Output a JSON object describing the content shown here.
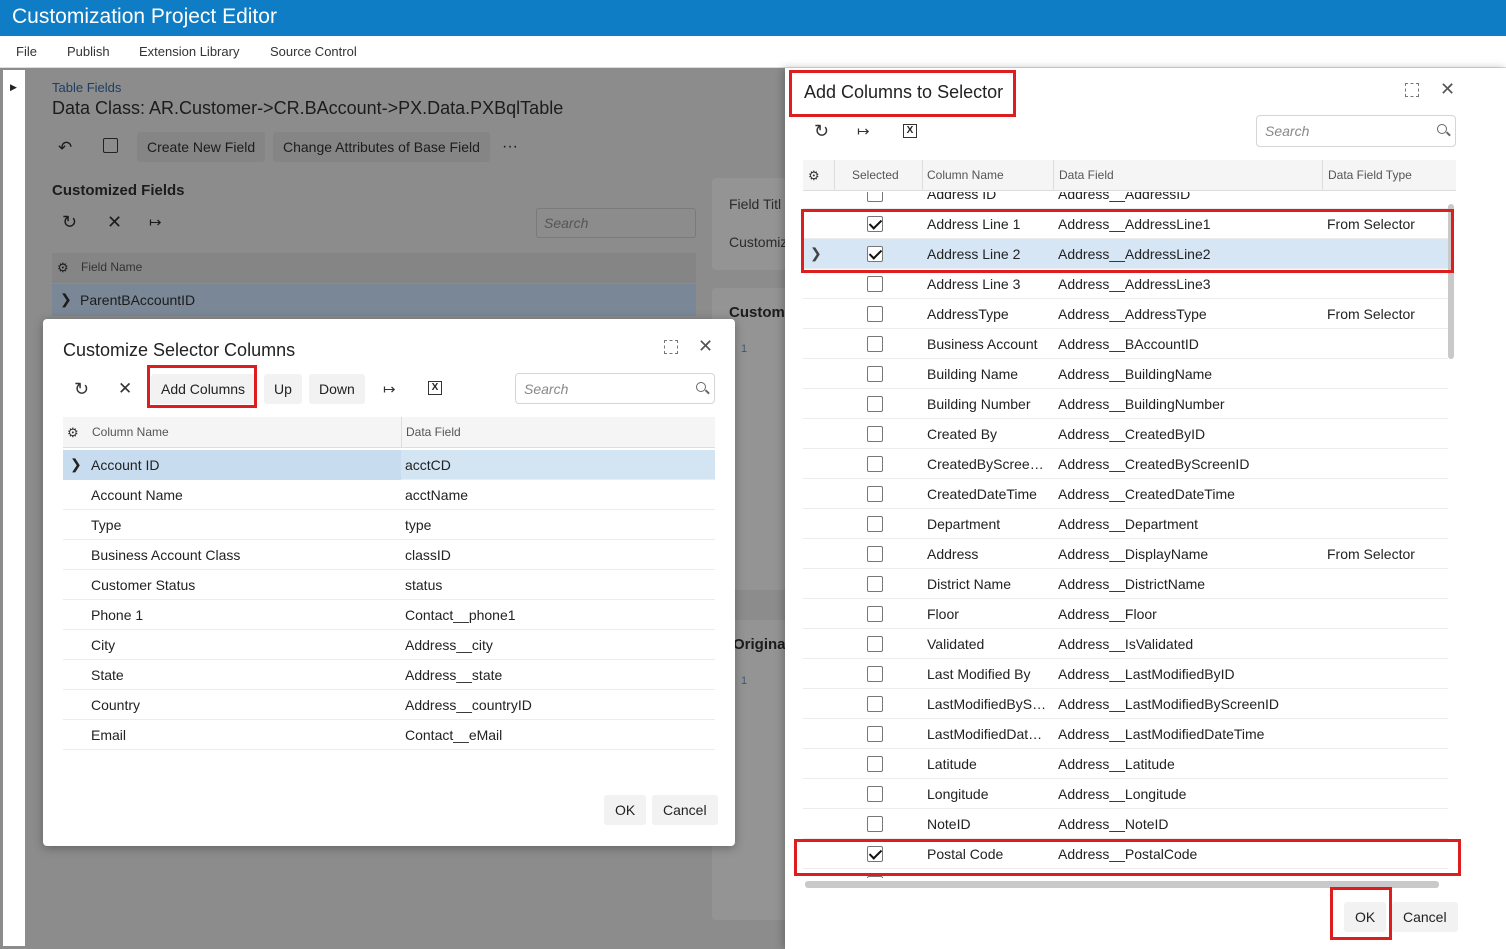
{
  "app_title": "Customization Project Editor",
  "menu": [
    "File",
    "Publish",
    "Extension Library",
    "Source Control"
  ],
  "background": {
    "breadcrumb": "Table Fields",
    "data_class": "Data Class: AR.Customer->CR.BAccount->PX.Data.PXBqlTable",
    "toolbar": {
      "create_new_field": "Create New Field",
      "change_attributes": "Change Attributes of Base Field",
      "more": "···"
    },
    "customized_fields_title": "Customized Fields",
    "search_placeholder": "Search",
    "field_name_header": "Field Name",
    "first_row": "ParentBAccountID",
    "field_title_label": "Field Titl",
    "customization_label": "Customiz",
    "custom_section": "Custom",
    "original_section": "Original",
    "line_number_1": "1",
    "line_number_2": "1"
  },
  "dialog1": {
    "title": "Customize Selector Columns",
    "toolbar": {
      "add_columns": "Add Columns",
      "up": "Up",
      "down": "Down"
    },
    "search_placeholder": "Search",
    "headers": {
      "column_name": "Column Name",
      "data_field": "Data Field"
    },
    "rows": [
      {
        "column_name": "Account ID",
        "data_field": "acctCD"
      },
      {
        "column_name": "Account Name",
        "data_field": "acctName"
      },
      {
        "column_name": "Type",
        "data_field": "type"
      },
      {
        "column_name": "Business Account Class",
        "data_field": "classID"
      },
      {
        "column_name": "Customer Status",
        "data_field": "status"
      },
      {
        "column_name": "Phone 1",
        "data_field": "Contact__phone1"
      },
      {
        "column_name": "City",
        "data_field": "Address__city"
      },
      {
        "column_name": "State",
        "data_field": "Address__state"
      },
      {
        "column_name": "Country",
        "data_field": "Address__countryID"
      },
      {
        "column_name": "Email",
        "data_field": "Contact__eMail"
      }
    ],
    "ok": "OK",
    "cancel": "Cancel"
  },
  "dialog2": {
    "title": "Add Columns to Selector",
    "search_placeholder": "Search",
    "headers": {
      "selected": "Selected",
      "column_name": "Column Name",
      "data_field": "Data Field",
      "data_field_type": "Data Field Type"
    },
    "partial_top_row": {
      "column_name": "Address ID",
      "data_field": "Address__AddressID"
    },
    "rows": [
      {
        "column_name": "Address Line 1",
        "data_field": "Address__AddressLine1",
        "type": "From Selector",
        "checked": true
      },
      {
        "column_name": "Address Line 2",
        "data_field": "Address__AddressLine2",
        "type": "",
        "checked": true
      },
      {
        "column_name": "Address Line 3",
        "data_field": "Address__AddressLine3",
        "type": "",
        "checked": false
      },
      {
        "column_name": "AddressType",
        "data_field": "Address__AddressType",
        "type": "From Selector",
        "checked": false
      },
      {
        "column_name": "Business Account",
        "data_field": "Address__BAccountID",
        "type": "",
        "checked": false
      },
      {
        "column_name": "Building Name",
        "data_field": "Address__BuildingName",
        "type": "",
        "checked": false
      },
      {
        "column_name": "Building Number",
        "data_field": "Address__BuildingNumber",
        "type": "",
        "checked": false
      },
      {
        "column_name": "Created By",
        "data_field": "Address__CreatedByID",
        "type": "",
        "checked": false
      },
      {
        "column_name": "CreatedByScreenID",
        "data_field": "Address__CreatedByScreenID",
        "type": "",
        "checked": false
      },
      {
        "column_name": "CreatedDateTime",
        "data_field": "Address__CreatedDateTime",
        "type": "",
        "checked": false
      },
      {
        "column_name": "Department",
        "data_field": "Address__Department",
        "type": "",
        "checked": false
      },
      {
        "column_name": "Address",
        "data_field": "Address__DisplayName",
        "type": "From Selector",
        "checked": false
      },
      {
        "column_name": "District Name",
        "data_field": "Address__DistrictName",
        "type": "",
        "checked": false
      },
      {
        "column_name": "Floor",
        "data_field": "Address__Floor",
        "type": "",
        "checked": false
      },
      {
        "column_name": "Validated",
        "data_field": "Address__IsValidated",
        "type": "",
        "checked": false
      },
      {
        "column_name": "Last Modified By",
        "data_field": "Address__LastModifiedByID",
        "type": "",
        "checked": false
      },
      {
        "column_name": "LastModifiedByScreenID",
        "data_field": "Address__LastModifiedByScreenID",
        "type": "",
        "checked": false
      },
      {
        "column_name": "LastModifiedDateTime",
        "data_field": "Address__LastModifiedDateTime",
        "type": "",
        "checked": false
      },
      {
        "column_name": "Latitude",
        "data_field": "Address__Latitude",
        "type": "",
        "checked": false
      },
      {
        "column_name": "Longitude",
        "data_field": "Address__Longitude",
        "type": "",
        "checked": false
      },
      {
        "column_name": "NoteID",
        "data_field": "Address__NoteID",
        "type": "",
        "checked": false
      },
      {
        "column_name": "Postal Code",
        "data_field": "Address__PostalCode",
        "type": "",
        "checked": true
      }
    ],
    "ok": "OK",
    "cancel": "Cancel"
  },
  "colors": {
    "brand": "#0e7dc5",
    "highlight": "#dc1e1e",
    "selected_row": "#d6e6f5"
  }
}
